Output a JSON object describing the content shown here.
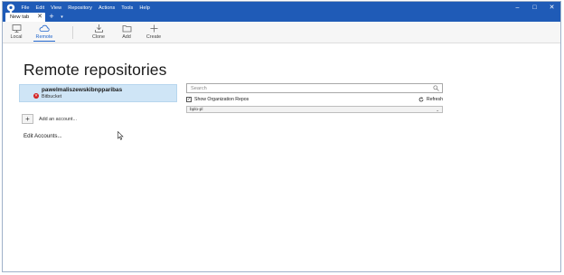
{
  "menu": [
    "File",
    "Edit",
    "View",
    "Repository",
    "Actions",
    "Tools",
    "Help"
  ],
  "window_controls": {
    "minimize": "–",
    "maximize": "□",
    "close": "✕"
  },
  "tab": {
    "label": "New tab",
    "close": "✕",
    "add": "+",
    "dropdown": "▾"
  },
  "toolbar": {
    "local": "Local",
    "remote": "Remote",
    "clone": "Clone",
    "add": "Add",
    "create": "Create"
  },
  "page_title": "Remote repositories",
  "account": {
    "name": "pawelmaliszewskibnpparibas",
    "provider": "Bitbucket",
    "status_icon": "error-icon",
    "status_glyph": "✕"
  },
  "add_account": {
    "glyph": "+",
    "label": "Add an account..."
  },
  "edit_accounts": "Edit Accounts...",
  "search": {
    "placeholder": "Search"
  },
  "show_org_repos": {
    "label": "Show Organization Repos",
    "checked": true,
    "check_glyph": "✓"
  },
  "refresh_label": "Refresh",
  "org_select": {
    "value": "bplo-pl",
    "chevron": "⌄"
  },
  "colors": {
    "titlebar": "#1f5bb7",
    "accent": "#2266cc",
    "selected_card": "#cfe5f6",
    "error": "#d21f1f"
  }
}
